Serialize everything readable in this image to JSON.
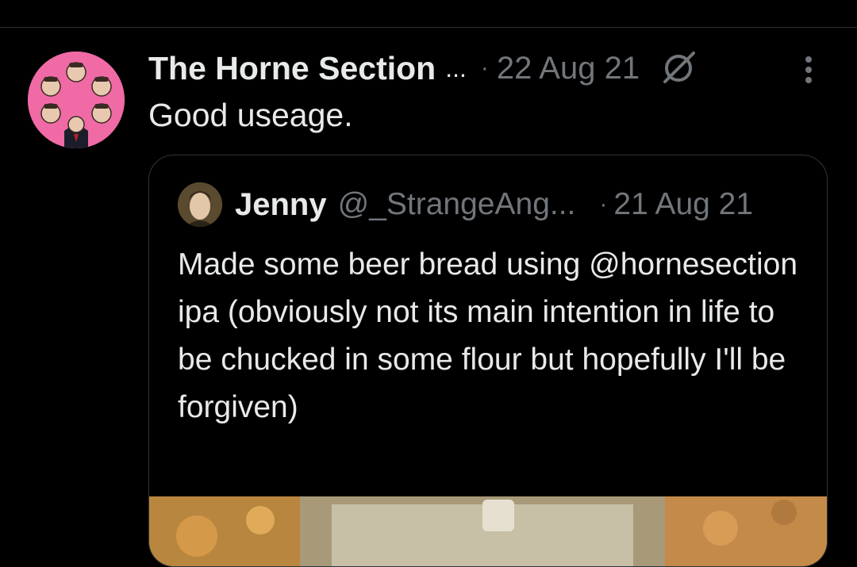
{
  "tweet": {
    "display_name": "The Horne Section",
    "name_ellipsis": "...",
    "separator": "·",
    "date": "22 Aug 21",
    "text": "Good useage."
  },
  "quote": {
    "display_name": "Jenny",
    "handle": "@_StrangeAng...",
    "separator": "·",
    "date": "21 Aug 21",
    "text": "Made some beer bread using @hornesection ipa (obviously not its main intention in life to be chucked in some flour but hopefully I'll be forgiven)"
  },
  "icons": {
    "grok": "grok-icon",
    "more": "more-vertical-icon"
  },
  "colors": {
    "background": "#000000",
    "primary_text": "#e7e9ea",
    "secondary_text": "#71767b",
    "border": "#2f3336",
    "avatar_pink": "#f06aa6"
  }
}
